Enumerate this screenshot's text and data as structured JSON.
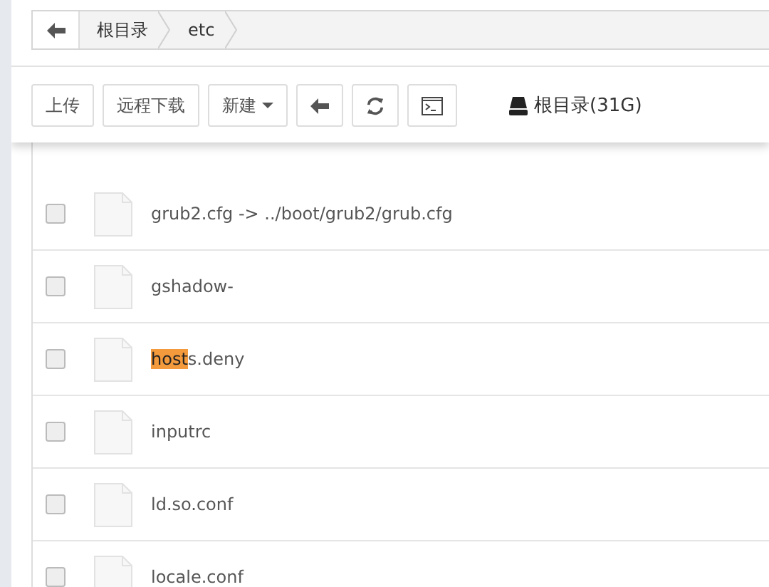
{
  "breadcrumb": {
    "items": [
      "根目录",
      "etc"
    ]
  },
  "toolbar": {
    "buttons": [
      {
        "kind": "text",
        "label": "上传"
      },
      {
        "kind": "text",
        "label": "远程下载"
      },
      {
        "kind": "dropdown",
        "label": "新建"
      },
      {
        "kind": "back"
      },
      {
        "kind": "refresh"
      },
      {
        "kind": "terminal"
      }
    ],
    "disk": "根目录(31G)"
  },
  "files": [
    {
      "checked": false,
      "name_parts": [
        {
          "text": "grub2.cfg -> ../boot/grub2/grub.cfg",
          "highlighted": false
        }
      ]
    },
    {
      "checked": false,
      "name_parts": [
        {
          "text": "gshadow-",
          "highlighted": false
        }
      ]
    },
    {
      "checked": false,
      "name_parts": [
        {
          "text": "host",
          "highlighted": true
        },
        {
          "text": "s.deny",
          "highlighted": false
        }
      ]
    },
    {
      "checked": false,
      "name_parts": [
        {
          "text": "inputrc",
          "highlighted": false
        }
      ]
    },
    {
      "checked": false,
      "name_parts": [
        {
          "text": "ld.so.conf",
          "highlighted": false
        }
      ]
    },
    {
      "checked": false,
      "name_parts": [
        {
          "text": "locale.conf",
          "highlighted": false
        }
      ]
    }
  ]
}
